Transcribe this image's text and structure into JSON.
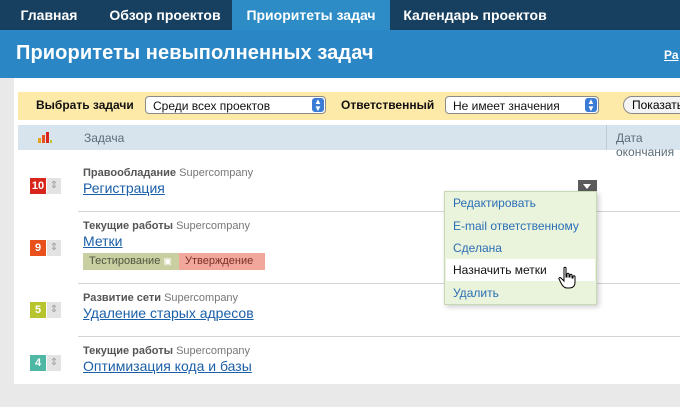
{
  "nav": {
    "tabs": [
      {
        "label": "Главная",
        "active": false
      },
      {
        "label": "Обзор проектов",
        "active": false
      },
      {
        "label": "Приоритеты задач",
        "active": true
      },
      {
        "label": "Календарь проектов",
        "active": false
      }
    ]
  },
  "header": {
    "title": "Приоритеты невыполненных задач",
    "side_link": "Ра"
  },
  "filter": {
    "choose_label": "Выбрать задачи",
    "choose_value": "Среди всех проектов",
    "responsible_label": "Ответственный",
    "responsible_value": "Не имеет значения",
    "show_button": "Показать"
  },
  "table": {
    "col_task": "Задача",
    "col_date": "Дата окончания",
    "rows": [
      {
        "priority": "10",
        "color": "#d9261c",
        "project": "Правообладание",
        "company": "Supercompany",
        "task": "Регистрация",
        "tags": []
      },
      {
        "priority": "9",
        "color": "#e8501e",
        "project": "Текущие работы",
        "company": "Supercompany",
        "task": "Метки",
        "tags": [
          {
            "label": "Тестирование",
            "bg": "#c9cfa0"
          },
          {
            "label": "Утверждение",
            "bg": "#f2a79d"
          }
        ]
      },
      {
        "priority": "5",
        "color": "#b8c42e",
        "project": "Развитие сети",
        "company": "Supercompany",
        "task": "Удаление старых адресов",
        "tags": []
      },
      {
        "priority": "4",
        "color": "#4fb8a4",
        "project": "Текущие работы",
        "company": "Supercompany",
        "task": "Оптимизация кода и базы",
        "tags": []
      }
    ]
  },
  "menu": {
    "items": [
      "Редактировать",
      "E-mail ответственному",
      "Сделана",
      "Назначить метки",
      "Удалить"
    ],
    "hover_index": 3
  },
  "colors": {
    "nav_bg": "#173f5f",
    "header_bg": "#2a86c4",
    "filter_bg": "#fde9a8",
    "link": "#1b5fa8"
  }
}
